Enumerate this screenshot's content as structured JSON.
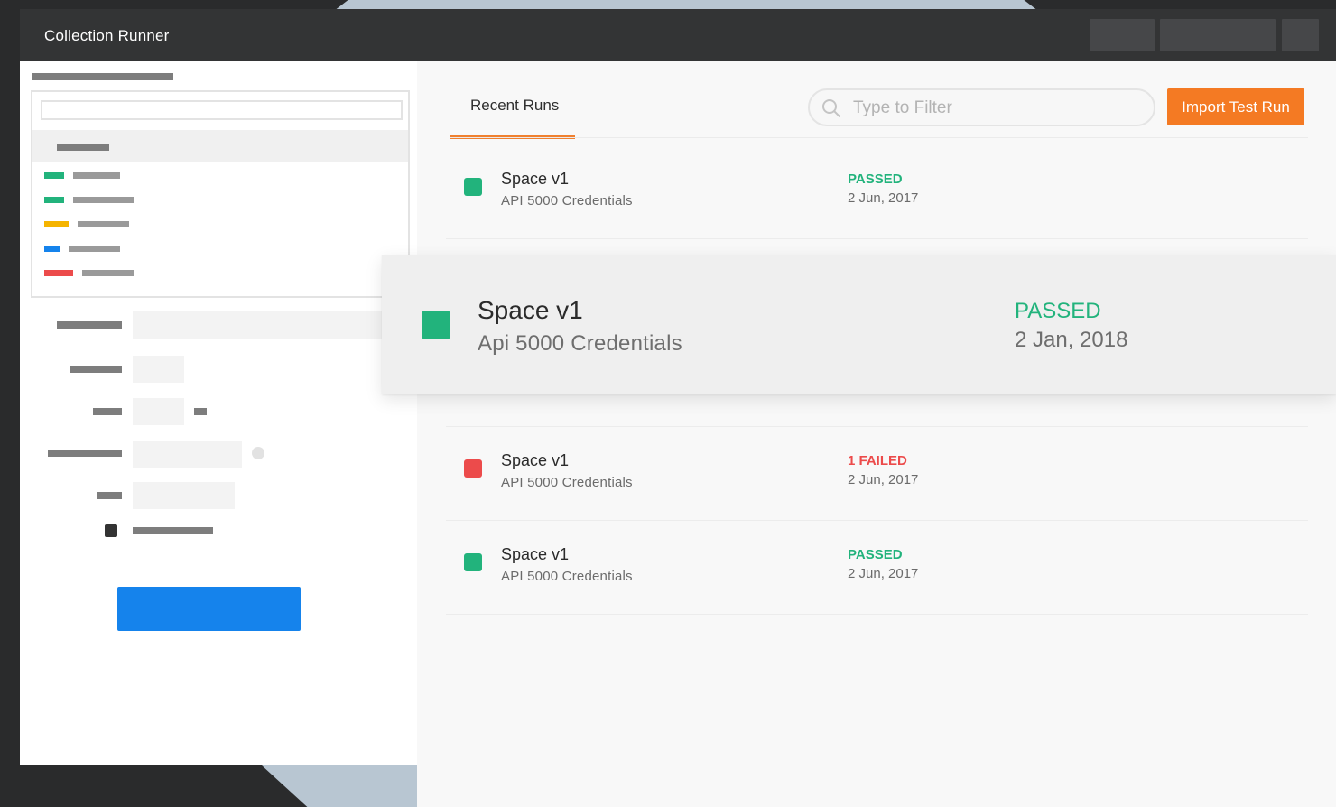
{
  "window": {
    "title": "Collection Runner"
  },
  "tabs": [
    {
      "label": "Recent Runs",
      "active": true
    }
  ],
  "filter": {
    "placeholder": "Type to Filter",
    "value": ""
  },
  "import_button": {
    "label": "Import Test Run"
  },
  "featured_run": {
    "name": "Space v1",
    "description": "Api 5000 Credentials",
    "status": "PASSED",
    "date": "2 Jan, 2018",
    "color": "#22b37c"
  },
  "runs": [
    {
      "name": "Space v1",
      "description": "API 5000 Credentials",
      "status": "PASSED",
      "date": "2 Jun, 2017",
      "color": "#22b37c"
    },
    {
      "name": "Space v1",
      "description": "API 5000 Credentials",
      "status": "1 FAILED",
      "date": "2 Jun, 2017",
      "color": "#ec4b4b"
    },
    {
      "name": "Space v1",
      "description": "API 5000 Credentials",
      "status": "PASSED",
      "date": "2 Jun, 2017",
      "color": "#22b37c"
    }
  ],
  "colors": {
    "accent": "#f47a23",
    "pass": "#22b37c",
    "fail": "#ec4b4b",
    "run_button": "#1583ec",
    "titlebar": "#333435"
  },
  "tree_swatch_colors": [
    "#22b37c",
    "#22b37c",
    "#f5b400",
    "#1583ec",
    "#ec4b4b"
  ],
  "icons": {
    "search": "search-icon",
    "status": "status-square-icon"
  }
}
